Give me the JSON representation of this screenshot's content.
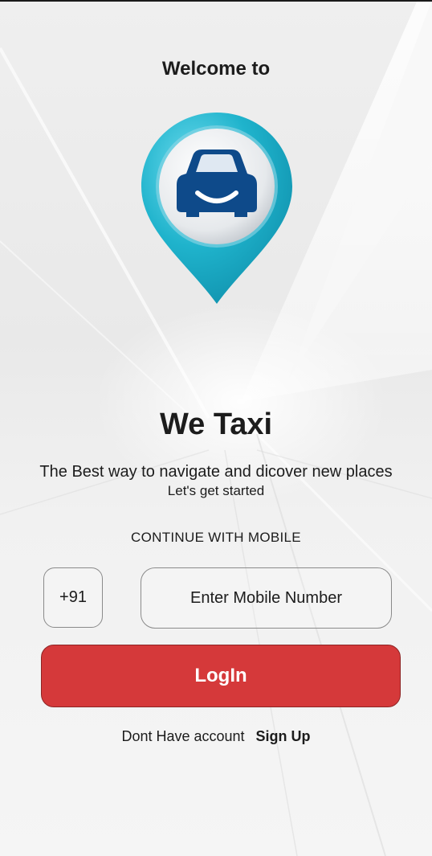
{
  "welcome_text": "Welcome to",
  "app_name": "We Taxi",
  "tagline": "The Best way to navigate and dicover new places",
  "sub_tagline": "Let's get started",
  "continue_label": "CONTINUE WITH MOBILE",
  "phone": {
    "country_code": "+91",
    "placeholder": "Enter Mobile Number",
    "value": ""
  },
  "login_label": "LogIn",
  "signup": {
    "prompt": "Dont Have account",
    "link_label": "Sign Up"
  },
  "colors": {
    "login_button": "#d5393a",
    "logo_pin": "#1fb3cc",
    "logo_car": "#0e4a8a",
    "text": "#1c1c1c"
  },
  "icons": {
    "logo": "map-pin-car-icon"
  }
}
